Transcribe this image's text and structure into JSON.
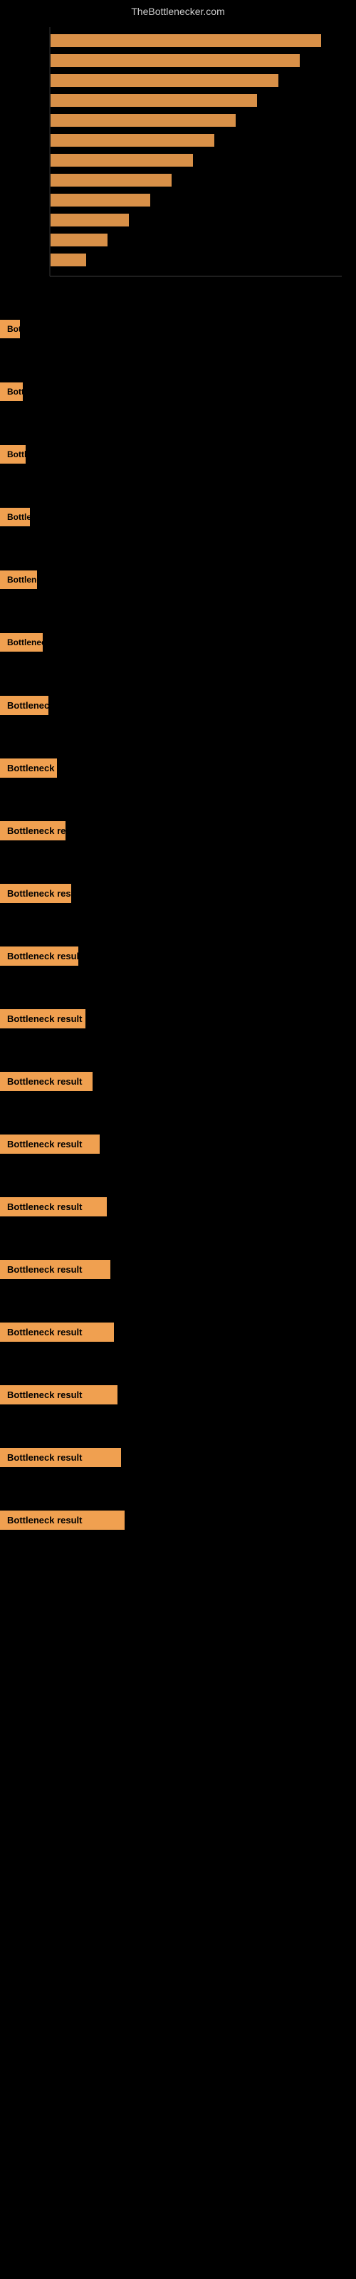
{
  "site": {
    "title": "TheBottlenecker.com"
  },
  "chart": {
    "description": "Bottleneck analysis chart"
  },
  "items": [
    {
      "id": 1,
      "label": "Bottleneck result",
      "width_class": "w1"
    },
    {
      "id": 2,
      "label": "Bottleneck result",
      "width_class": "w2"
    },
    {
      "id": 3,
      "label": "Bottleneck result",
      "width_class": "w3"
    },
    {
      "id": 4,
      "label": "Bottleneck result",
      "width_class": "w4"
    },
    {
      "id": 5,
      "label": "Bottleneck result",
      "width_class": "w5"
    },
    {
      "id": 6,
      "label": "Bottleneck result",
      "width_class": "w6"
    },
    {
      "id": 7,
      "label": "Bottleneck result",
      "width_class": "w7"
    },
    {
      "id": 8,
      "label": "Bottleneck result",
      "width_class": "w8"
    },
    {
      "id": 9,
      "label": "Bottleneck result",
      "width_class": "w9"
    },
    {
      "id": 10,
      "label": "Bottleneck result",
      "width_class": "w10"
    },
    {
      "id": 11,
      "label": "Bottleneck result",
      "width_class": "w11"
    },
    {
      "id": 12,
      "label": "Bottleneck result",
      "width_class": "w12"
    },
    {
      "id": 13,
      "label": "Bottleneck result",
      "width_class": "w13"
    },
    {
      "id": 14,
      "label": "Bottleneck result",
      "width_class": "w14"
    },
    {
      "id": 15,
      "label": "Bottleneck result",
      "width_class": "w15"
    },
    {
      "id": 16,
      "label": "Bottleneck result",
      "width_class": "w16"
    },
    {
      "id": 17,
      "label": "Bottleneck result",
      "width_class": "w17"
    },
    {
      "id": 18,
      "label": "Bottleneck result",
      "width_class": "w18"
    },
    {
      "id": 19,
      "label": "Bottleneck result",
      "width_class": "w19"
    },
    {
      "id": 20,
      "label": "Bottleneck result",
      "width_class": "w20"
    }
  ]
}
